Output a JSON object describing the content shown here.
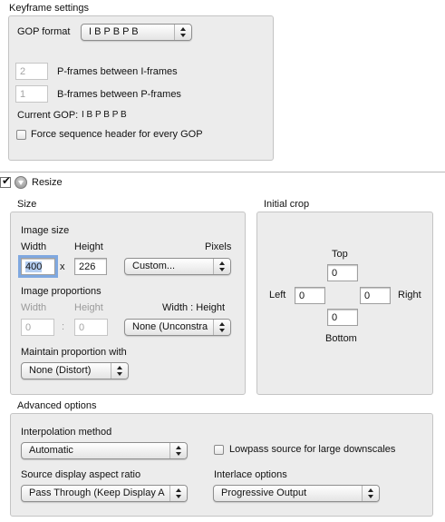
{
  "keyframe": {
    "title": "Keyframe settings",
    "gop_format_label": "GOP format",
    "gop_format_value": "I B P B P B",
    "p_frames_value": "2",
    "p_frames_label": "P-frames between I-frames",
    "b_frames_value": "1",
    "b_frames_label": "B-frames between P-frames",
    "current_gop_label": "Current GOP:",
    "current_gop_value": "I B P B P B",
    "force_header_label": "Force sequence header for every GOP",
    "force_header_checked": false
  },
  "resize": {
    "label": "Resize",
    "enabled": true,
    "size_title": "Size",
    "image_size_label": "Image size",
    "width_label": "Width",
    "height_label": "Height",
    "pixels_label": "Pixels",
    "width_value": "400",
    "times_sign": "x",
    "height_value": "226",
    "size_preset": "Custom...",
    "image_proportions_label": "Image proportions",
    "prop_width_label": "Width",
    "prop_height_label": "Height",
    "ratio_label": "Width : Height",
    "prop_width_value": "0",
    "colon": ":",
    "prop_height_value": "0",
    "ratio_preset": "None (Unconstra",
    "maintain_label": "Maintain proportion with",
    "maintain_value": "None (Distort)",
    "crop_title": "Initial crop",
    "top_label": "Top",
    "top_value": "0",
    "left_label": "Left",
    "left_value": "0",
    "right_value": "0",
    "right_label": "Right",
    "bottom_value": "0",
    "bottom_label": "Bottom"
  },
  "advanced": {
    "title": "Advanced options",
    "interpolation_label": "Interpolation method",
    "interpolation_value": "Automatic",
    "lowpass_label": "Lowpass source for large downscales",
    "lowpass_checked": false,
    "aspect_label": "Source display aspect ratio",
    "aspect_value": "Pass Through (Keep Display A",
    "interlace_label": "Interlace options",
    "interlace_value": "Progressive Output"
  }
}
